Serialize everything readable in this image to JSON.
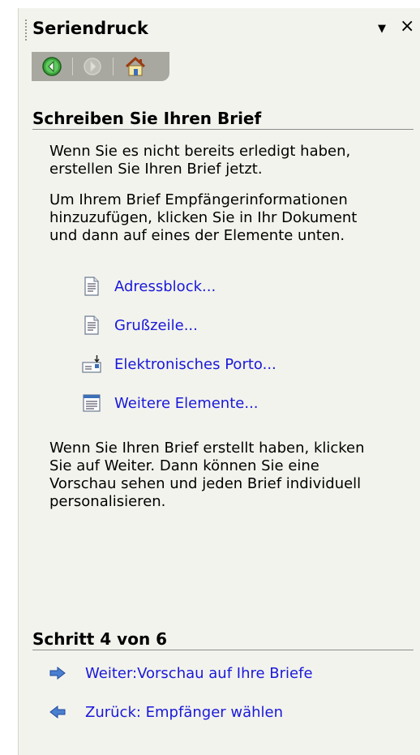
{
  "pane": {
    "title": "Seriendruck",
    "dropdown_glyph": "▼",
    "close_glyph": "×"
  },
  "toolbar": {
    "back_icon": "back-arrow-icon",
    "forward_icon": "forward-arrow-icon",
    "home_icon": "home-icon"
  },
  "section1": {
    "heading": "Schreiben Sie Ihren Brief",
    "para1": [
      "Wenn Sie es nicht bereits erledigt haben,",
      "erstellen Sie Ihren Brief jetzt."
    ],
    "para2": [
      "Um Ihrem Brief Empfängerinformationen",
      "hinzuzufügen, klicken Sie in Ihr Dokument",
      "und dann auf eines der Elemente unten."
    ],
    "items": [
      {
        "label": "Adressblock...",
        "icon": "document-icon"
      },
      {
        "label": "Grußzeile...",
        "icon": "document-icon"
      },
      {
        "label": "Elektronisches Porto...",
        "icon": "postage-icon"
      },
      {
        "label": "Weitere Elemente...",
        "icon": "list-document-icon"
      }
    ],
    "para3": [
      "Wenn Sie Ihren Brief erstellt haben, klicken",
      "Sie auf Weiter. Dann können Sie eine",
      "Vorschau sehen und jeden Brief individuell",
      "personalisieren."
    ]
  },
  "step": {
    "heading": "Schritt 4 von 6",
    "next_label": "Weiter:Vorschau auf Ihre Briefe",
    "back_label": "Zurück: Empfänger wählen"
  },
  "colors": {
    "pane_bg": "#f3f3ee",
    "link": "#1919d9",
    "toolbar_bg": "#a8a8a0"
  }
}
